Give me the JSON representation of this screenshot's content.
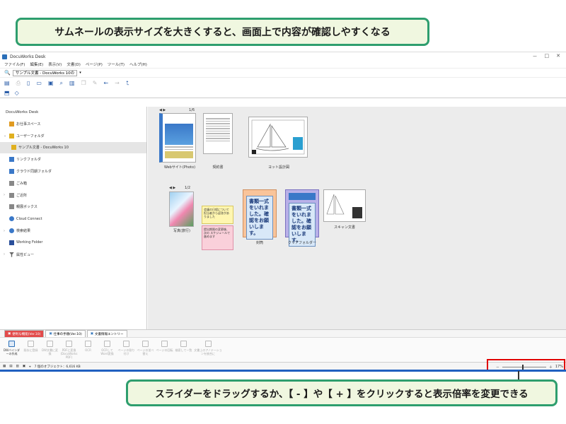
{
  "callouts": {
    "top": "サムネールの表示サイズを大きくすると、画面上で内容が確認しやすくなる",
    "bottom": "スライダーをドラッグするか、【 - 】や【 + 】をクリックすると表示倍率を変更できる"
  },
  "window": {
    "title": "DocuWorks Desk"
  },
  "menu": [
    "ファイル(F)",
    "編集(E)",
    "表示(V)",
    "文書(D)",
    "ページ(P)",
    "ツール(T)",
    "ヘルプ(H)"
  ],
  "address": {
    "value": "サンプル文書 - DocuWorks 10の"
  },
  "sidebar": {
    "header": "DocuWorks Desk",
    "items": [
      {
        "label": "お仕事スペース",
        "icon": "workspace-icon",
        "color": "#e09a20"
      },
      {
        "label": "ユーザーフォルダ",
        "icon": "folder-icon",
        "color": "#e0b020"
      },
      {
        "label": "サンプル文書 - DocuWorks 10",
        "icon": "folder-icon",
        "color": "#e0b020"
      },
      {
        "label": "リンクフォルダ",
        "icon": "link-folder-icon",
        "color": "#3a78c8"
      },
      {
        "label": "クラウド同期フォルダ",
        "icon": "cloud-sync-icon",
        "color": "#3a78c8"
      },
      {
        "label": "ごみ箱",
        "icon": "trash-icon",
        "color": "#777777"
      },
      {
        "label": "ご近所",
        "icon": "network-icon",
        "color": "#777777"
      },
      {
        "label": "親展ボックス",
        "icon": "inbox-icon",
        "color": "#777777"
      },
      {
        "label": "Cloud Connect",
        "icon": "cloud-icon",
        "color": "#3a78c8"
      },
      {
        "label": "検索結果",
        "icon": "search-icon",
        "color": "#3a78c8"
      },
      {
        "label": "Working Folder",
        "icon": "working-folder-icon",
        "color": "#2a4f9a"
      },
      {
        "label": "属性ビュー",
        "icon": "filter-icon",
        "color": "#555555"
      }
    ]
  },
  "thumbnails": {
    "row1": [
      {
        "label": "Webサイト(Photo)",
        "pager": "1/6"
      },
      {
        "label": "契約書"
      },
      {
        "label": "ヨット設計図"
      }
    ],
    "row2": [
      {
        "label": "写真(旅行)",
        "pager": "1/2"
      },
      {
        "label": ""
      },
      {
        "label": "封筒"
      },
      {
        "label": "クリアフォルダー"
      },
      {
        "label": "スキャン文書"
      }
    ],
    "sticky_yellow": "会議の日程について 担当者から返答がありました",
    "sticky_pink": "提出期限の変更後、次の スケジュールで進めます",
    "envelope_text": "書類一式をいれました。確認をお願いします。",
    "clear_folder_text": "書類一式をいれました。確認をお願いします。"
  },
  "tabs": [
    "便利な機能(Ver.10)",
    "仕事の手順(Ver.10)",
    "文書情報エントリー"
  ],
  "actions": [
    "DWバインダーの作成",
    "既存に登録",
    "DW文書に変換",
    "PDFに変換(DocuWorks PDF)",
    "OCR",
    "OCRしてWord変換",
    "ページの割り付け",
    "ページの並べ替え",
    "ページの回転",
    "検索して一覧",
    "文書上のアノテーションを統合に"
  ],
  "status": {
    "text": "7 個のオブジェクト：6,616 KB",
    "zoom": "17%",
    "minus": "－",
    "plus": "＋",
    "slider_level": 0.45
  }
}
